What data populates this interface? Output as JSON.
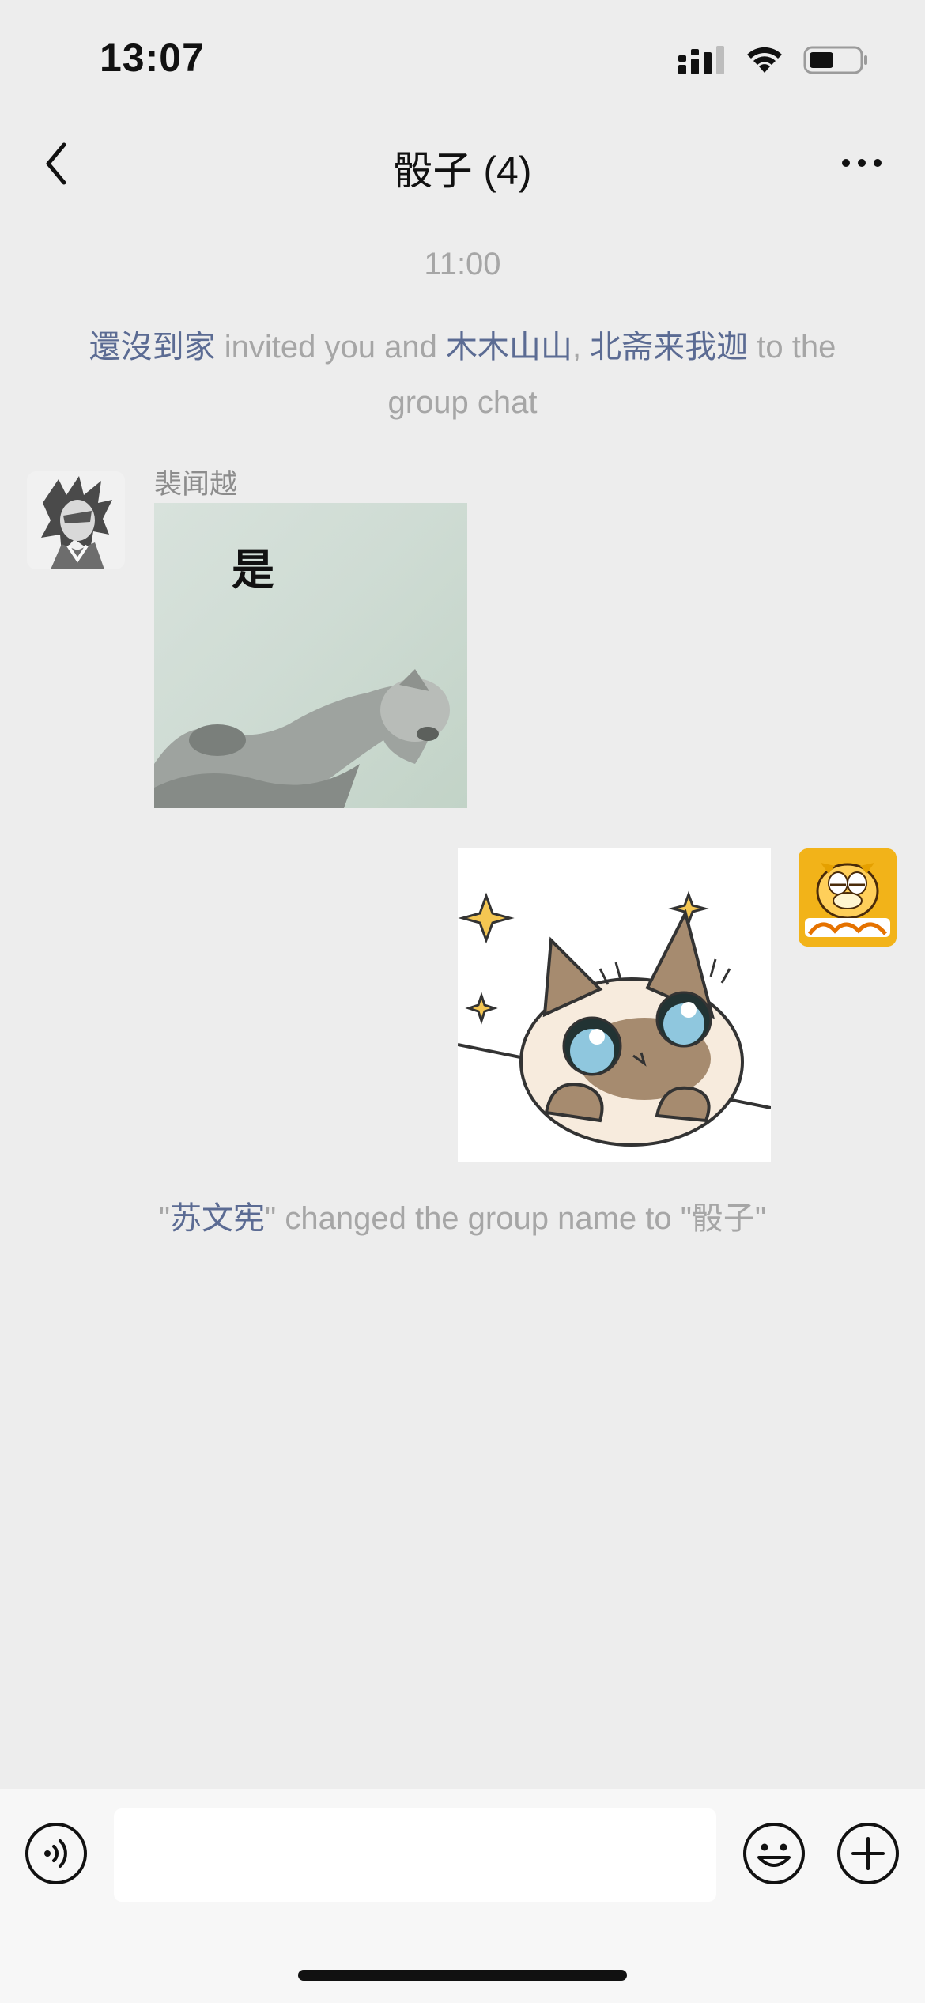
{
  "status_bar": {
    "time": "13:07",
    "battery_level": 0.45
  },
  "nav": {
    "title": "骰子 (4)"
  },
  "chat": {
    "timestamp": "11:00",
    "invite_message": {
      "inviter": "還沒到家",
      "text_invited": " invited you and ",
      "invitee1": "木木山山",
      "separator": ", ",
      "invitee2": "北斋来我迦",
      "text_to": " to the group chat"
    },
    "message1": {
      "sender": "裴闻越",
      "sticker_text": "是"
    },
    "rename_message": {
      "quote_open": "\"",
      "name": "苏文宪",
      "text_changed": "\" changed the group name to \"骰子\""
    }
  },
  "input_bar": {
    "value": "",
    "placeholder": ""
  },
  "colors": {
    "background": "#ededed",
    "link": "#5b6b93",
    "system_text": "#a6a6a6",
    "input_bar": "#f7f7f7"
  }
}
